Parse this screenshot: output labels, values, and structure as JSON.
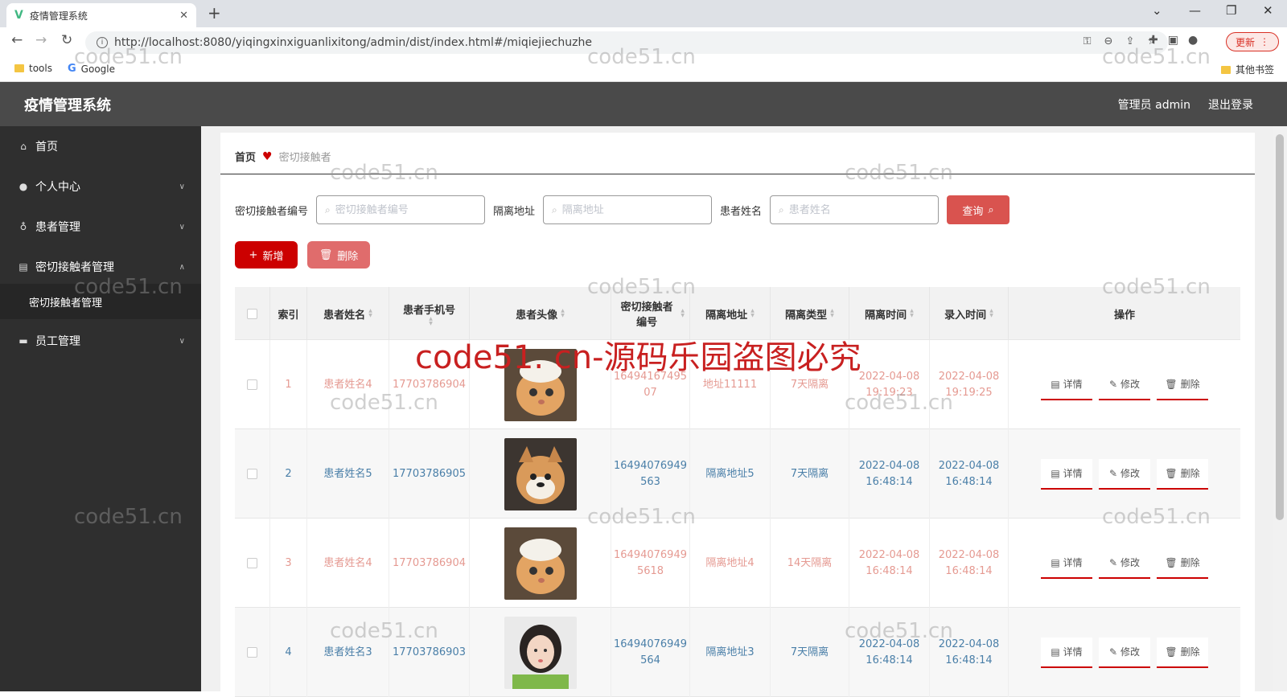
{
  "browser": {
    "tab_title": "疫情管理系统",
    "url": "http://localhost:8080/yiqingxinxiguanlixitong/admin/dist/index.html#/miqiejiechuzhe",
    "update_label": "更新",
    "bookmarks": [
      "tools",
      "Google"
    ],
    "other_bookmarks": "其他书签"
  },
  "header": {
    "title": "疫情管理系统",
    "user": "管理员 admin",
    "logout": "退出登录"
  },
  "sidebar": {
    "items": [
      {
        "label": "首页",
        "icon": "home-icon"
      },
      {
        "label": "个人中心",
        "icon": "user-icon"
      },
      {
        "label": "患者管理",
        "icon": "mic-icon"
      },
      {
        "label": "密切接触者管理",
        "icon": "card-icon"
      },
      {
        "label": "员工管理",
        "icon": "monitor-icon"
      }
    ],
    "sub_item": "密切接触者管理"
  },
  "breadcrumb": {
    "home": "首页",
    "current": "密切接触者"
  },
  "search": {
    "label1": "密切接触者编号",
    "placeholder1": "密切接触者编号",
    "label2": "隔离地址",
    "placeholder2": "隔离地址",
    "label3": "患者姓名",
    "placeholder3": "患者姓名",
    "query_label": "查询"
  },
  "actions": {
    "add_label": "新增",
    "delete_label": "删除"
  },
  "table": {
    "headers": [
      "索引",
      "患者姓名",
      "患者手机号",
      "患者头像",
      "密切接触者编号",
      "隔离地址",
      "隔离类型",
      "隔离时间",
      "录入时间",
      "操作"
    ],
    "ops": [
      "详情",
      "修改",
      "删除"
    ],
    "rows": [
      {
        "index": "1",
        "name": "患者姓名4",
        "phone": "17703786904",
        "avatar": "cat",
        "code": "16494167495 07",
        "addr": "地址11111",
        "type": "7天隔离",
        "iso_time": "2022-04-08 19:19:23",
        "entry_time": "2022-04-08 19:19:25",
        "color": "red"
      },
      {
        "index": "2",
        "name": "患者姓名5",
        "phone": "17703786905",
        "avatar": "dog",
        "code": "16494076949 563",
        "addr": "隔离地址5",
        "type": "7天隔离",
        "iso_time": "2022-04-08 16:48:14",
        "entry_time": "2022-04-08 16:48:14",
        "color": "blue"
      },
      {
        "index": "3",
        "name": "患者姓名4",
        "phone": "17703786904",
        "avatar": "cat",
        "code": "16494076949 5618",
        "addr": "隔离地址4",
        "type": "14天隔离",
        "iso_time": "2022-04-08 16:48:14",
        "entry_time": "2022-04-08 16:48:14",
        "color": "red"
      },
      {
        "index": "4",
        "name": "患者姓名3",
        "phone": "17703786903",
        "avatar": "girl",
        "code": "16494076949 564",
        "addr": "隔离地址3",
        "type": "7天隔离",
        "iso_time": "2022-04-08 16:48:14",
        "entry_time": "2022-04-08 16:48:14",
        "color": "blue"
      }
    ]
  },
  "watermark": {
    "small": "code51.cn",
    "big": "code51. cn-源码乐园盗图必究"
  }
}
